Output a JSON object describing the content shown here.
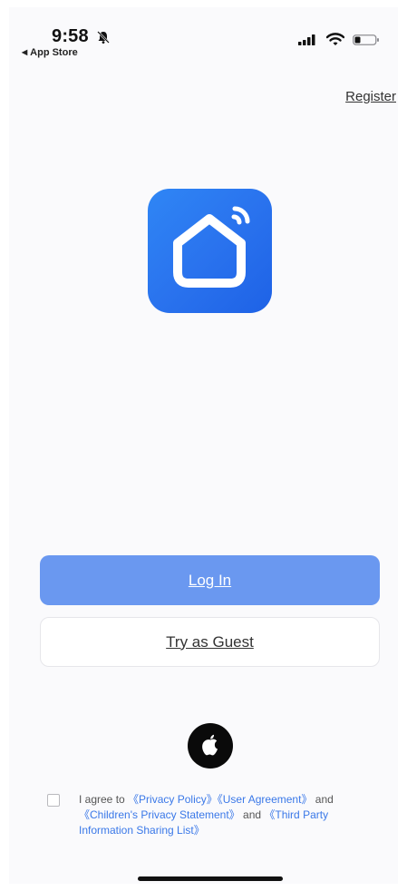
{
  "status_bar": {
    "time": "9:58",
    "back_app": "App Store"
  },
  "header": {
    "register_label": "Register"
  },
  "app_icon": {
    "icon": "smart-home-icon",
    "colors": [
      "#2f86f5",
      "#1e62e6"
    ]
  },
  "buttons": {
    "login_label": "Log In",
    "guest_label": "Try as Guest",
    "login_color": "#6a98f0"
  },
  "social": {
    "icon": "apple-icon"
  },
  "agreement": {
    "checked": false,
    "prefix": "I agree to ",
    "privacy_policy": "《Privacy Policy》",
    "user_agreement": "《User Agreement》",
    "and1": " and ",
    "childrens_privacy": "《Children's Privacy Statement》",
    "and2": " and ",
    "third_party": "《Third Party Information Sharing List》",
    "link_color": "#3a78e8"
  }
}
